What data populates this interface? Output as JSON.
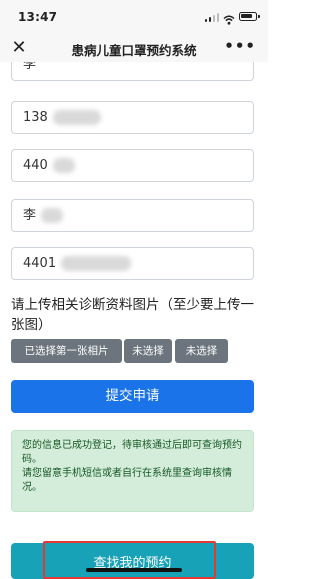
{
  "status": {
    "time": "13:47"
  },
  "navbar": {
    "title": "患病儿童口罩预约系统"
  },
  "form": {
    "name_partial": "李",
    "phone": "138",
    "id_number": "440",
    "guardian_name": "李",
    "guardian_id": "4401",
    "upload_label": "请上传相关诊断资料图片（至少要上传一张图）",
    "file_buttons": [
      "已选择第一张相片",
      "未选择",
      "未选择"
    ],
    "submit_label": "提交申请"
  },
  "notice": {
    "line1": "您的信息已成功登记，待审核通过后即可查询预约码。",
    "line2": "请您留意手机短信或者自行在系统里查询审核情况。"
  },
  "query_label": "查找我的预约",
  "colors": {
    "primary": "#1a73e8",
    "secondary": "#6c757d",
    "success_bg": "#d4edda",
    "info": "#17a2b8",
    "highlight": "#e53935"
  }
}
